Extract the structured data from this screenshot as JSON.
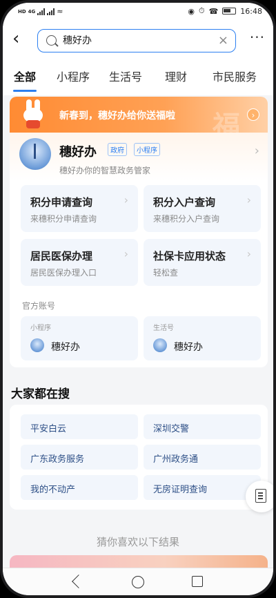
{
  "status_bar": {
    "network": "HD",
    "carrier_tag": "4G",
    "time": "16:48"
  },
  "search": {
    "value": "穗好办"
  },
  "tabs": [
    {
      "label": "全部",
      "active": true
    },
    {
      "label": "小程序"
    },
    {
      "label": "生活号"
    },
    {
      "label": "理财"
    },
    {
      "label": "市民服务"
    }
  ],
  "banner": {
    "text": "新春到，穗好办给你送福啦",
    "decor_char": "福"
  },
  "app": {
    "name": "穗好办",
    "tags": [
      "政府",
      "小程序"
    ],
    "desc": "穗好办你的智慧政务管家",
    "logo_text": "穗好办"
  },
  "services": [
    {
      "title": "积分申请查询",
      "sub": "来穗积分申请查询"
    },
    {
      "title": "积分入户查询",
      "sub": "来穗积分入户查询"
    },
    {
      "title": "居民医保办理",
      "sub": "居民医保办理入口"
    },
    {
      "title": "社保卡应用状态",
      "sub": "轻松查"
    }
  ],
  "official": {
    "label": "官方账号",
    "accounts": [
      {
        "type": "小程序",
        "name": "穗好办"
      },
      {
        "type": "生活号",
        "name": "穗好办"
      }
    ]
  },
  "popular": {
    "title": "大家都在搜",
    "items": [
      "平安白云",
      "深圳交警",
      "广东政务服务",
      "广州政务通",
      "我的不动产",
      "无房证明查询"
    ]
  },
  "guess_title": "猜你喜欢以下结果"
}
